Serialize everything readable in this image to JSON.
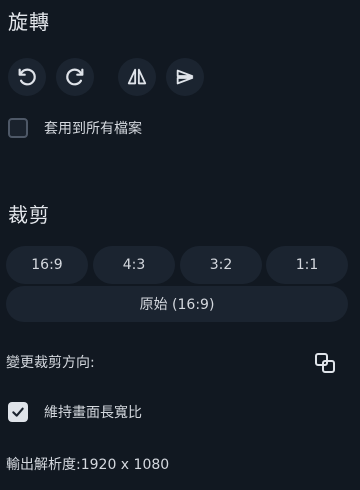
{
  "rotate": {
    "title": "旋轉",
    "buttons": [
      {
        "icon": "rotate-left-icon"
      },
      {
        "icon": "rotate-right-icon"
      },
      {
        "icon": "flip-horizontal-icon"
      },
      {
        "icon": "flip-vertical-icon"
      }
    ],
    "apply_all": {
      "label": "套用到所有檔案",
      "checked": false
    }
  },
  "crop": {
    "title": "裁剪",
    "ratios": [
      "16:9",
      "4:3",
      "3:2",
      "1:1"
    ],
    "original_label": "原始 (16:9)",
    "orientation_label": "變更裁剪方向:",
    "orientation_icon": "swap-orientation-icon",
    "keep_ratio": {
      "label": "維持畫面長寬比",
      "checked": true
    }
  },
  "output": {
    "resolution_text": "輸出解析度:1920 x 1080"
  },
  "colors": {
    "background": "#111821",
    "button_bg": "#1b2430",
    "text": "#d9dde3"
  }
}
